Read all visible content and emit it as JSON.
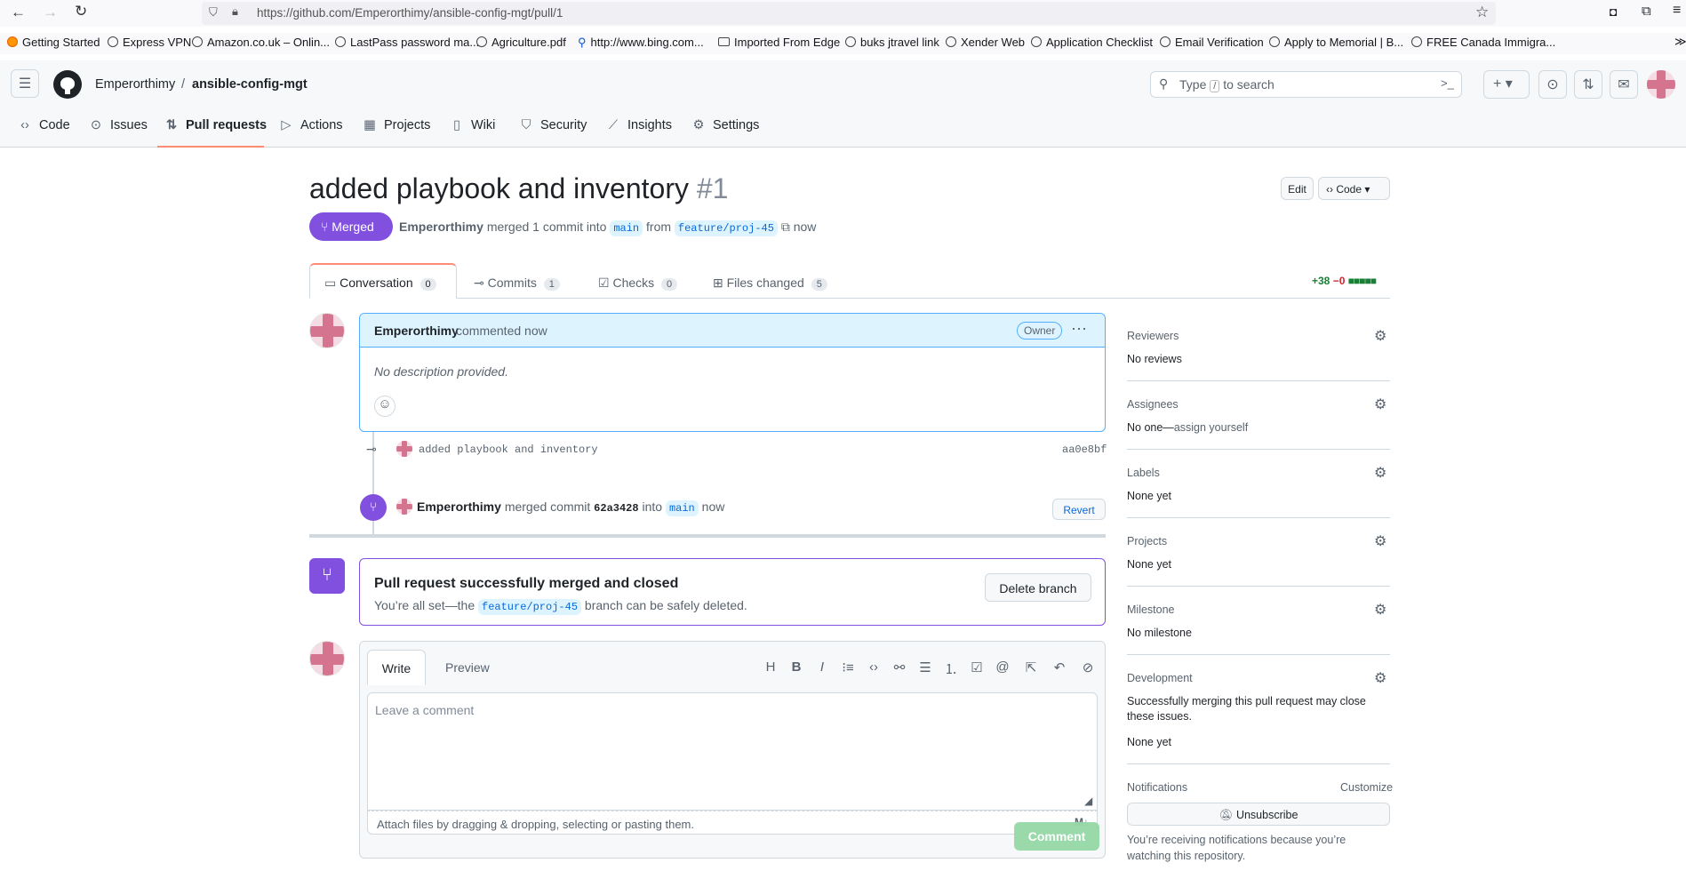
{
  "browser": {
    "url": "https://github.com/Emperorthimy/ansible-config-mgt/pull/1",
    "bookmarks": [
      "Getting Started",
      "Express VPN",
      "Amazon.co.uk – Onlin...",
      "LastPass password ma...",
      "Agriculture.pdf",
      "http://www.bing.com...",
      "Imported From Edge",
      "buks jtravel link",
      "Xender Web",
      "Application Checklist",
      "Email Verification",
      "Apply to Memorial | B...",
      "FREE Canada Immigra..."
    ]
  },
  "header": {
    "owner": "Emperorthimy",
    "separator": "/",
    "repo": "ansible-config-mgt",
    "search_prefix": "Type",
    "search_key": "/",
    "search_suffix": "to search"
  },
  "repo_tabs": [
    "Code",
    "Issues",
    "Pull requests",
    "Actions",
    "Projects",
    "Wiki",
    "Security",
    "Insights",
    "Settings"
  ],
  "pr": {
    "title": "added playbook and inventory",
    "number": "#1",
    "edit_label": "Edit",
    "code_label": "Code",
    "state": "Merged",
    "author": "Emperorthimy",
    "merged_text": "merged 1 commit into",
    "base": "main",
    "from_text": "from",
    "head": "feature/proj-45",
    "time": "now",
    "tabs": [
      {
        "label": "Conversation",
        "count": "0"
      },
      {
        "label": "Commits",
        "count": "1"
      },
      {
        "label": "Checks",
        "count": "0"
      },
      {
        "label": "Files changed",
        "count": "5"
      }
    ],
    "additions": "+38",
    "deletions": "−0"
  },
  "comment": {
    "author": "Emperorthimy",
    "time_text": "commented now",
    "badge": "Owner",
    "body": "No description provided."
  },
  "commit": {
    "message": "added playbook and inventory",
    "sha": "aa0e8bf"
  },
  "merge_event": {
    "author": "Emperorthimy",
    "text1": "merged commit",
    "sha": "62a3428",
    "text2": "into",
    "branch": "main",
    "time": "now",
    "revert": "Revert"
  },
  "merged_box": {
    "title": "Pull request successfully merged and closed",
    "text1": "You’re all set—the",
    "branch": "feature/proj-45",
    "text2": "branch can be safely deleted.",
    "delete_label": "Delete branch"
  },
  "editor": {
    "write": "Write",
    "preview": "Preview",
    "placeholder": "Leave a comment",
    "attach": "Attach files by dragging & dropping, selecting or pasting them.",
    "submit": "Comment"
  },
  "sidebar": {
    "reviewers_title": "Reviewers",
    "reviewers_value": "No reviews",
    "assignees_title": "Assignees",
    "assignees_value": "No one—",
    "assign_link": "assign yourself",
    "labels_title": "Labels",
    "labels_value": "None yet",
    "projects_title": "Projects",
    "projects_value": "None yet",
    "milestone_title": "Milestone",
    "milestone_value": "No milestone",
    "development_title": "Development",
    "development_text": "Successfully merging this pull request may close these issues.",
    "development_value": "None yet",
    "notifications_title": "Notifications",
    "customize": "Customize",
    "unsubscribe": "Unsubscribe",
    "notify_text": "You’re receiving notifications because you’re watching this repository."
  },
  "colors": {
    "merged": "#8250df",
    "link": "#0969da",
    "green": "#1a7f37",
    "red": "#d1242f",
    "accent_border": "#fd8c73"
  }
}
